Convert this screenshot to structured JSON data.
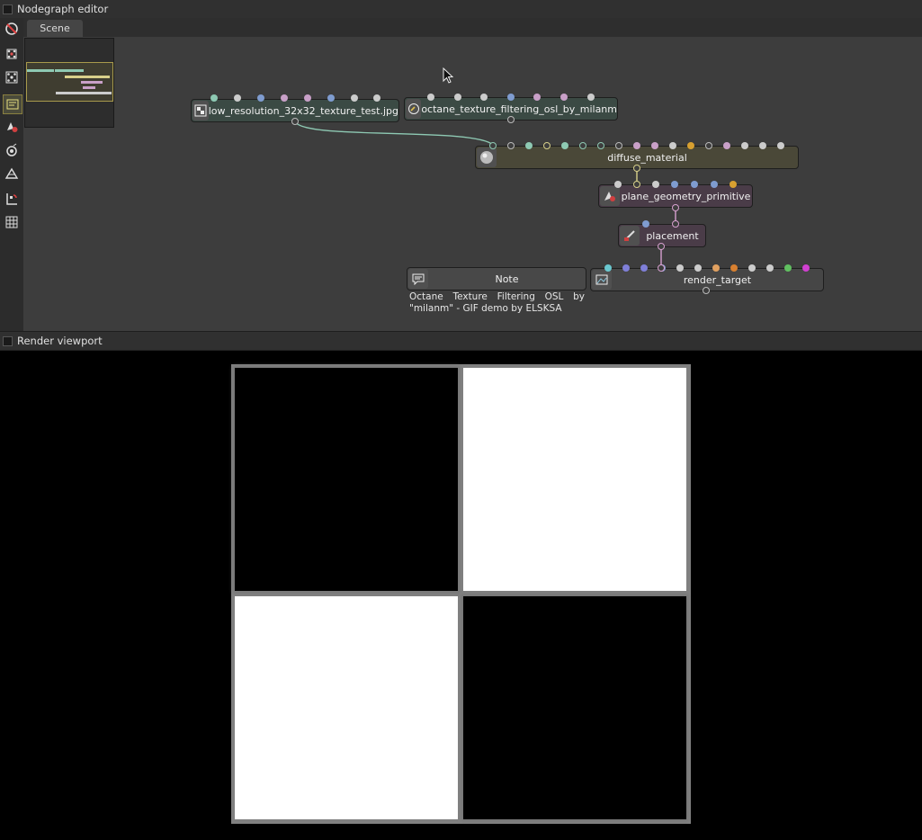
{
  "nodegraph": {
    "panel_title": "Nodegraph editor",
    "tab_label": "Scene",
    "nodes": {
      "texture": {
        "label": "low_resolution_32x32_texture_test.jpg"
      },
      "osl": {
        "label": "octane_texture_filtering_osl_by_milanm"
      },
      "material": {
        "label": "diffuse_material"
      },
      "geometry": {
        "label": "plane_geometry_primitive"
      },
      "placement": {
        "label": "placement"
      },
      "note": {
        "label": "Note",
        "text": "Octane Texture Filtering OSL by \"milanm\" - GIF demo by ELSKSA"
      },
      "render_target": {
        "label": "render_target"
      }
    },
    "toolbar_icons": [
      "unlink-icon",
      "collapse-nodes-icon",
      "expand-nodes-icon",
      "scene-icon",
      "material-icon",
      "camera-icon",
      "geometry-icon",
      "render-target-icon",
      "grid-icon"
    ]
  },
  "viewport": {
    "panel_title": "Render viewport",
    "checker": [
      "black",
      "white",
      "white",
      "black"
    ]
  },
  "colors": {
    "panel_bg": "#3d3d3d",
    "texture_node": "#3b4a44",
    "material_node": "#4a4838",
    "geometry_node": "#4a3c48",
    "note_node": "#484848",
    "render_target_node": "#464646",
    "wire_teal": "#8ec9b3",
    "wire_yellow": "#d8d08a",
    "wire_pink": "#d8a0d0"
  }
}
